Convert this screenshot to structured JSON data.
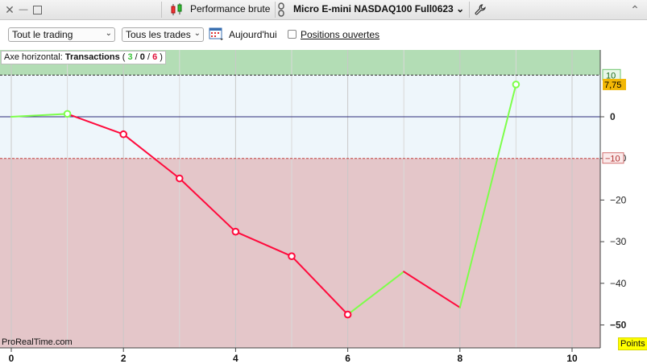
{
  "titlebar": {
    "close_glyph": "✕",
    "minimize_glyph": "—",
    "report_title": "Performance brute",
    "instrument": "Micro E-mini NASDAQ100 Full0623",
    "instrument_chevron": "⌄",
    "collapse_glyph": "⌃",
    "icons": [
      "close-icon",
      "minimize-icon",
      "maximize-icon",
      "candlestick-icon",
      "link-icon",
      "wrench-icon",
      "collapse-icon"
    ]
  },
  "toolbar": {
    "filter_trading": "Tout le trading",
    "filter_trades": "Tous les trades",
    "chevron": "⌄",
    "period_label": "Aujourd'hui",
    "open_positions_label": "Positions ouvertes",
    "open_positions_checked": false
  },
  "axis_box": {
    "prefix": "Axe horizontal:",
    "title": "Transactions",
    "open_paren": "(",
    "wins": "3",
    "sep1": "/",
    "neutral": "0",
    "sep2": "/",
    "losses": "6",
    "close_paren": ")"
  },
  "watermark": "ProRealTime.com",
  "units_badge": "Points",
  "colors": {
    "win_line": "#7dff4a",
    "loss_line": "#ff0a3c",
    "zero_line": "#2a2a7a",
    "profit_zone": "#b3ddb5",
    "loss_zone": "#e4c6c9",
    "neutral_zone": "#eef6fb",
    "last_value_badge": "#f2b705",
    "units_badge_bg": "#ffff00"
  },
  "chart_data": {
    "type": "line",
    "x": [
      0,
      1,
      2,
      3,
      4,
      5,
      6,
      7,
      8,
      9
    ],
    "y": [
      0,
      0.7,
      -4.2,
      -14.8,
      -27.6,
      -33.5,
      -47.5,
      -37.2,
      -45.8,
      7.75
    ],
    "segment_result": [
      "win",
      "loss",
      "loss",
      "loss",
      "loss",
      "loss",
      "win",
      "loss",
      "win"
    ],
    "markers": [
      1,
      2,
      3,
      4,
      5,
      6,
      9
    ],
    "xlim": [
      0,
      10.5
    ],
    "ylim": [
      -55,
      10.5
    ],
    "xticks": [
      "0",
      "2",
      "4",
      "6",
      "8",
      "10"
    ],
    "xtick_values": [
      0,
      2,
      4,
      6,
      8,
      10
    ],
    "yticks": [
      "0",
      "−10",
      "−20",
      "−30",
      "−40",
      "−50"
    ],
    "ytick_values": [
      0,
      -10,
      -20,
      -30,
      -40,
      -50
    ],
    "reference_lines": {
      "upper": 10,
      "upper_label": "10",
      "lower": -10,
      "lower_label": "−10"
    },
    "last_value": "7,75",
    "last_value_y": 7.75,
    "grid": true
  }
}
